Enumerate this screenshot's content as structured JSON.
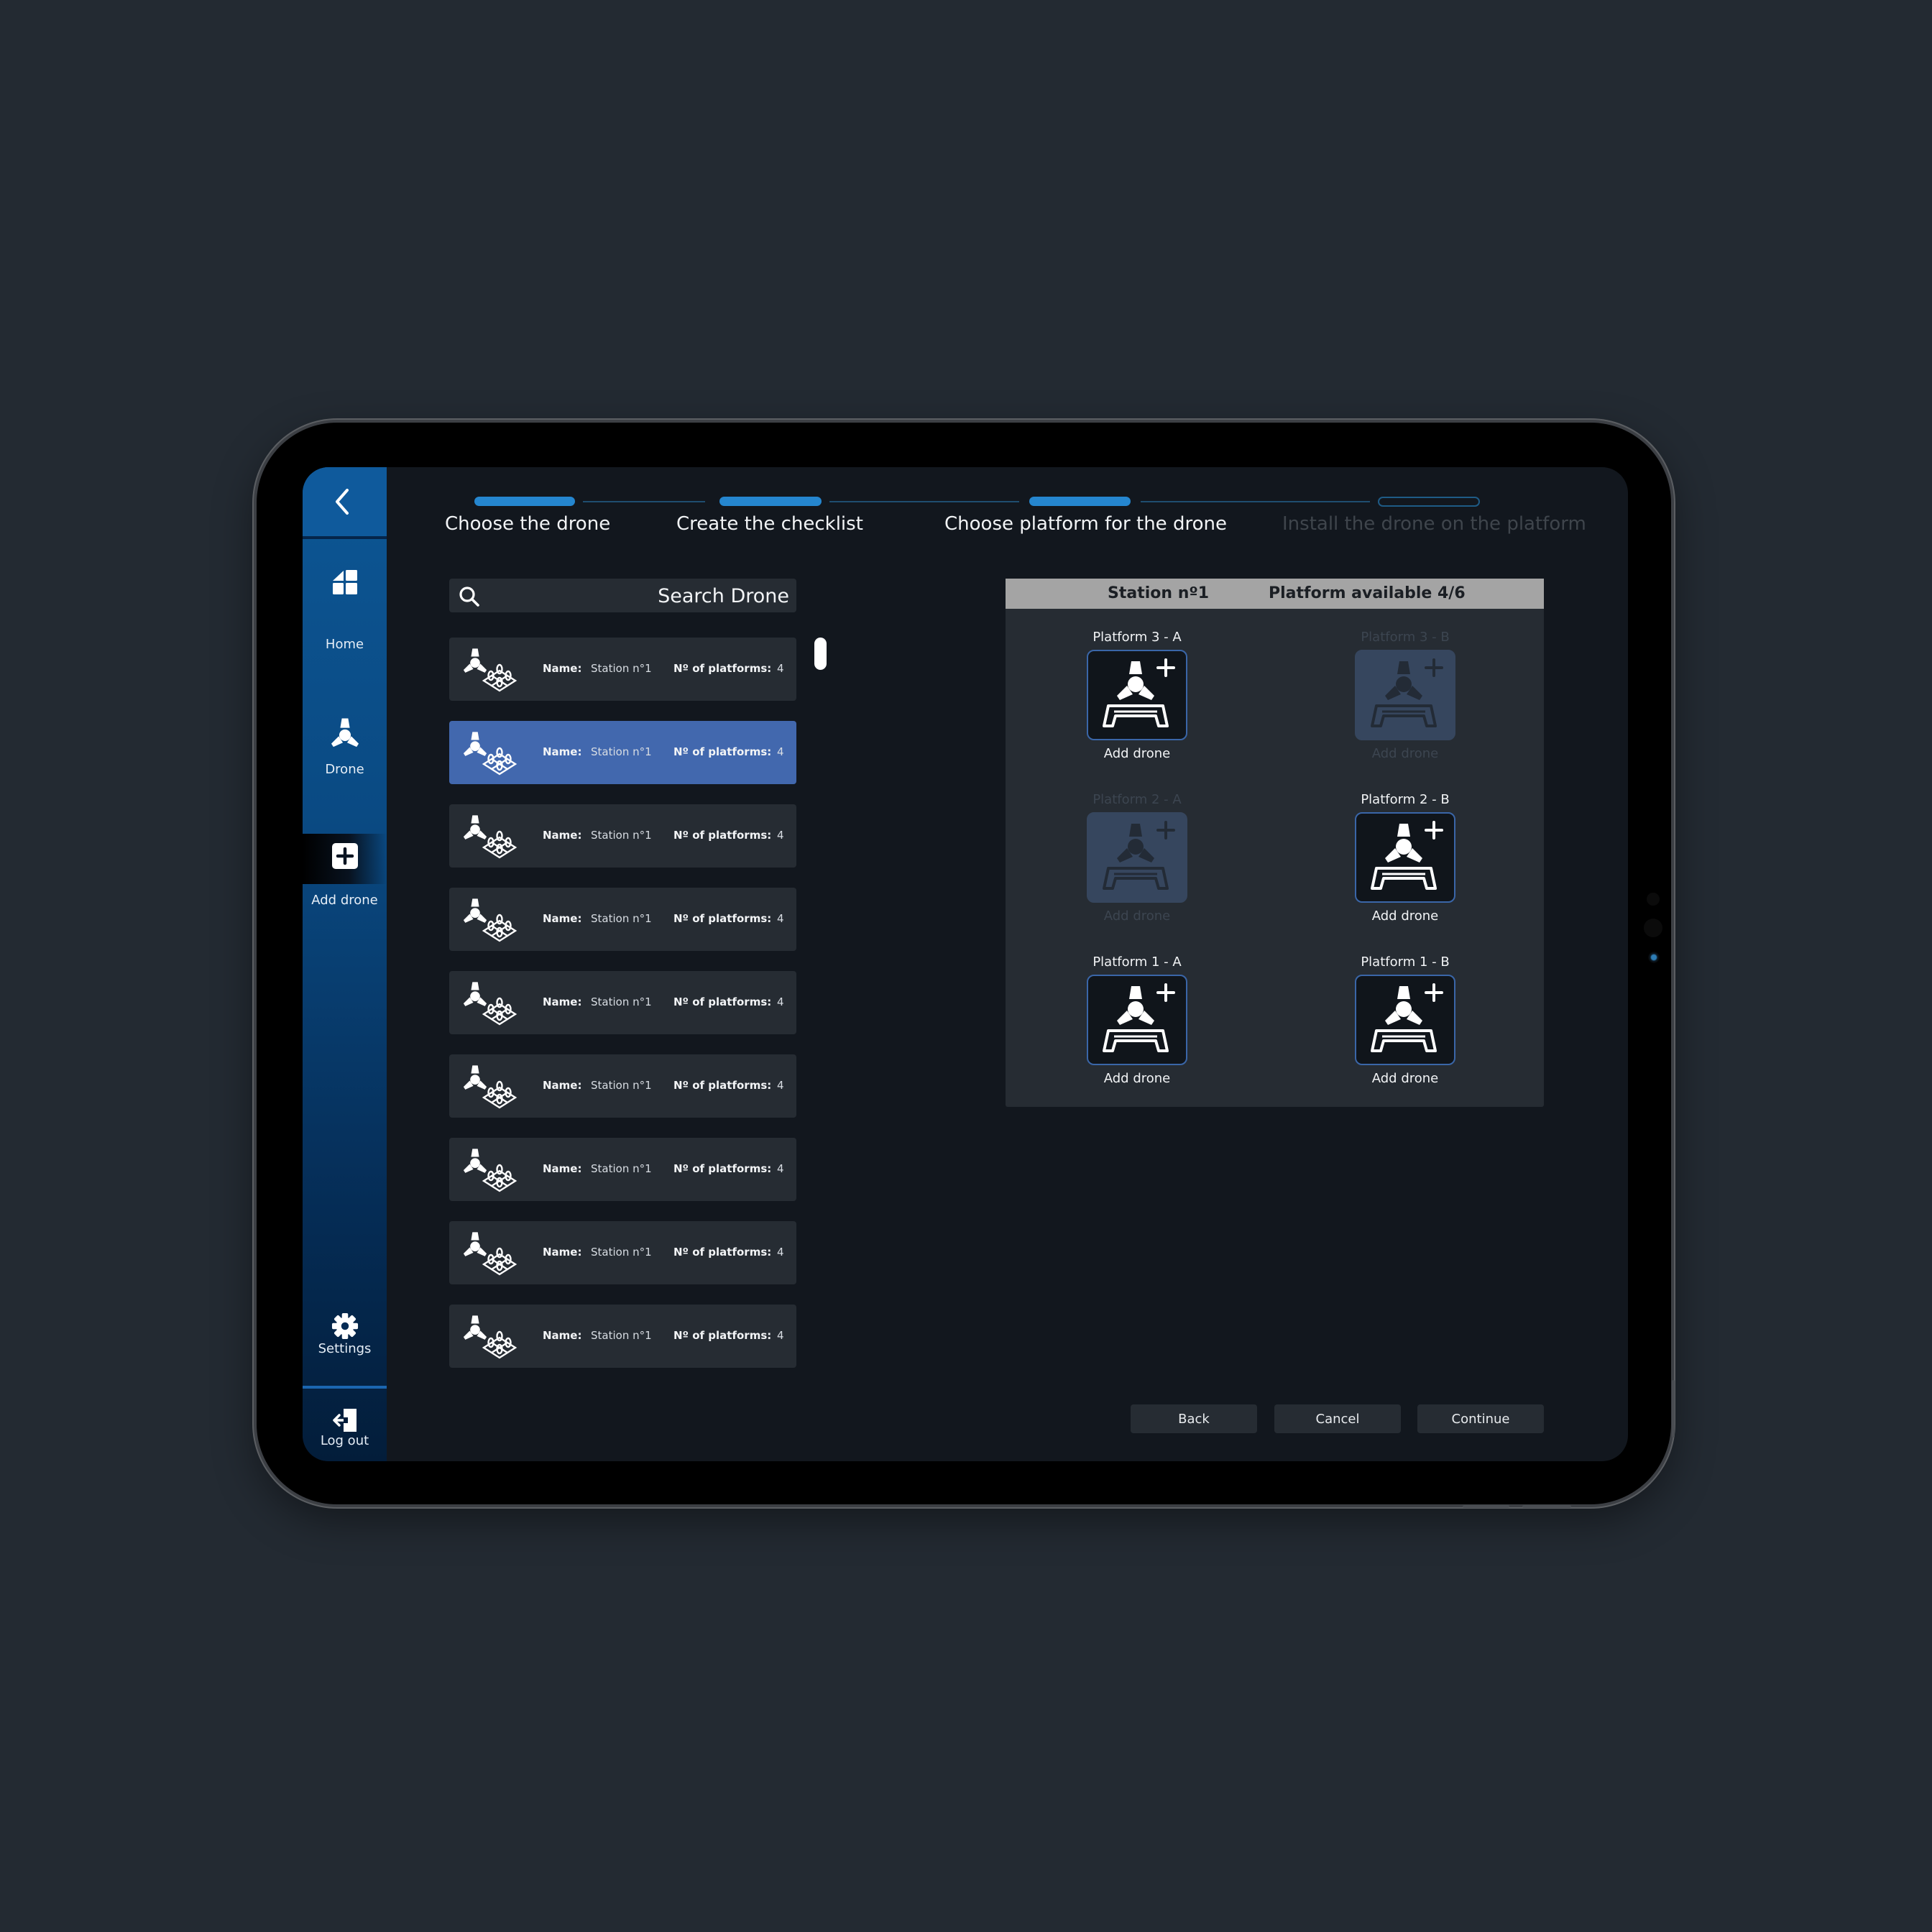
{
  "colors": {
    "background": "#232a32",
    "accent": "#2586cf",
    "selected_row": "#4268ae",
    "sidebar_top": "#0d5694",
    "sidebar_bottom": "#031d3a",
    "panel_header": "#a4a4a4"
  },
  "sidebar": {
    "back_icon": "chevron-left-icon",
    "items": [
      {
        "label": "Home",
        "icon": "home-grid-icon"
      },
      {
        "label": "Drone",
        "icon": "drone-icon"
      },
      {
        "label": "Add drone",
        "icon": "plus-square-icon",
        "active": true
      },
      {
        "label": "Settings",
        "icon": "gear-icon"
      },
      {
        "label": "Log out",
        "icon": "logout-icon"
      }
    ]
  },
  "stepper": {
    "steps": [
      {
        "label": "Choose the drone",
        "state": "done"
      },
      {
        "label": "Create the checklist",
        "state": "done"
      },
      {
        "label": "Choose platform for the drone",
        "state": "current"
      },
      {
        "label": "Install the drone on the platform",
        "state": "upcoming"
      }
    ]
  },
  "search": {
    "placeholder": "Search Drone",
    "value": ""
  },
  "stations": {
    "name_label": "Name:",
    "platforms_label": "Nº of platforms:",
    "items": [
      {
        "name": "Station n°1",
        "platforms": "4",
        "selected": false
      },
      {
        "name": "Station n°1",
        "platforms": "4",
        "selected": true
      },
      {
        "name": "Station n°1",
        "platforms": "4",
        "selected": false
      },
      {
        "name": "Station n°1",
        "platforms": "4",
        "selected": false
      },
      {
        "name": "Station n°1",
        "platforms": "4",
        "selected": false
      },
      {
        "name": "Station n°1",
        "platforms": "4",
        "selected": false
      },
      {
        "name": "Station n°1",
        "platforms": "4",
        "selected": false
      },
      {
        "name": "Station n°1",
        "platforms": "4",
        "selected": false
      },
      {
        "name": "Station n°1",
        "platforms": "4",
        "selected": false
      }
    ]
  },
  "platform_panel": {
    "station": "Station nº1",
    "availability": "Platform available 4/6",
    "platforms": [
      {
        "name": "Platform 3 - A",
        "action": "Add drone",
        "available": true
      },
      {
        "name": "Platform 3 - B",
        "action": "Add drone",
        "available": false
      },
      {
        "name": "Platform 2 - A",
        "action": "Add drone",
        "available": false
      },
      {
        "name": "Platform 2 - B",
        "action": "Add drone",
        "available": true
      },
      {
        "name": "Platform 1 - A",
        "action": "Add drone",
        "available": true
      },
      {
        "name": "Platform 1 - B",
        "action": "Add drone",
        "available": true
      }
    ]
  },
  "actions": {
    "back": "Back",
    "cancel": "Cancel",
    "continue": "Continue"
  }
}
